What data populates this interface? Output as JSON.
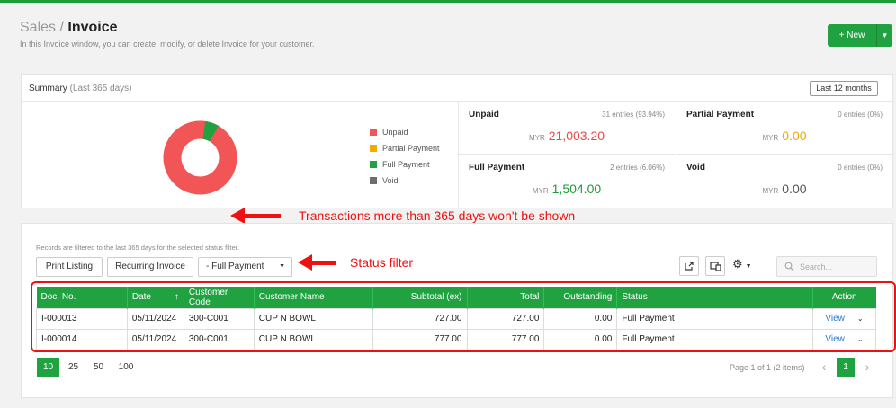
{
  "header": {
    "breadcrumb_parent": "Sales /",
    "title": "Invoice",
    "subtitle": "In this Invoice window, you can create, modify, or delete Invoice for your customer.",
    "new_button": "+ New"
  },
  "summary": {
    "heading": "Summary",
    "period": "(Last 365 days)",
    "range_button": "Last 12 months",
    "legend": [
      {
        "label": "Unpaid",
        "color": "#f25555"
      },
      {
        "label": "Partial Payment",
        "color": "#f2a900"
      },
      {
        "label": "Full Payment",
        "color": "#21a241"
      },
      {
        "label": "Void",
        "color": "#6e6e6e"
      }
    ],
    "donut_shares": {
      "unpaid": 0.9394,
      "full_payment": 0.0606
    },
    "stats": {
      "unpaid": {
        "label": "Unpaid",
        "entries": "31 entries (93.94%)",
        "currency": "MYR",
        "amount": "21,003.20",
        "color": "#e64b4b"
      },
      "partial": {
        "label": "Partial Payment",
        "entries": "0 entries (0%)",
        "currency": "MYR",
        "amount": "0.00",
        "color": "#f2a900"
      },
      "full": {
        "label": "Full Payment",
        "entries": "2 entries (6.06%)",
        "currency": "MYR",
        "amount": "1,504.00",
        "color": "#1e9b3a"
      },
      "void": {
        "label": "Void",
        "entries": "0 entries (0%)",
        "currency": "MYR",
        "amount": "0.00",
        "color": "#555555"
      }
    }
  },
  "annotations": {
    "transactions": "Transactions more than 365 days won't be shown",
    "status_filter": "Status filter"
  },
  "listing": {
    "note": "Records are filtered to the last 365 days for the selected status filter.",
    "print_listing": "Print Listing",
    "recurring_invoice": "Recurring Invoice",
    "status_value": "- Full Payment",
    "search_placeholder": "Search...",
    "columns": [
      "Doc. No.",
      "Date",
      "Customer Code",
      "Customer Name",
      "Subtotal (ex)",
      "Total",
      "Outstanding",
      "Status",
      "Action"
    ],
    "rows": [
      {
        "doc": "I-000013",
        "date": "05/11/2024",
        "code": "300-C001",
        "name": "CUP N BOWL",
        "subtotal": "727.00",
        "total": "727.00",
        "outstanding": "0.00",
        "status": "Full Payment",
        "action": "View"
      },
      {
        "doc": "I-000014",
        "date": "05/11/2024",
        "code": "300-C001",
        "name": "CUP N BOWL",
        "subtotal": "777.00",
        "total": "777.00",
        "outstanding": "0.00",
        "status": "Full Payment",
        "action": "View"
      }
    ],
    "page_sizes": [
      "10",
      "25",
      "50",
      "100"
    ],
    "page_info": "Page 1 of 1 (2 items)",
    "current_page": "1"
  }
}
